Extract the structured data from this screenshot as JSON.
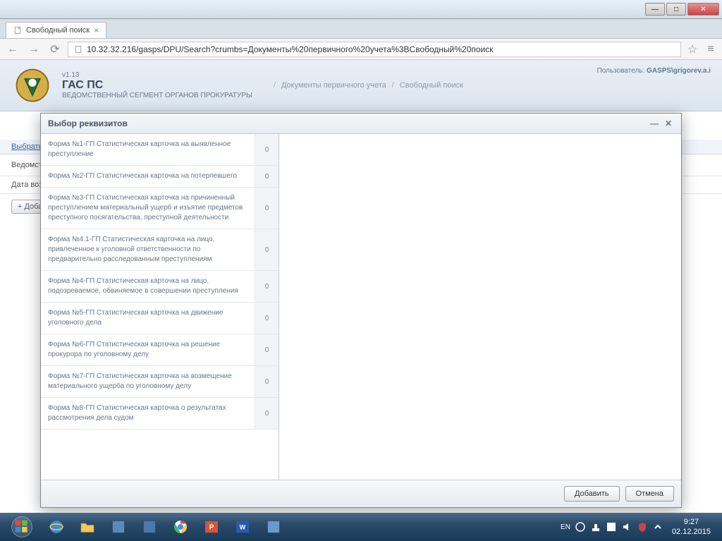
{
  "window": {
    "minimize": "—",
    "maximize": "□",
    "close": "✕"
  },
  "tab": {
    "title": "Свободный поиск",
    "close": "×"
  },
  "addr": {
    "back": "←",
    "fwd": "→",
    "reload": "⟳",
    "url": "10.32.32.216/gasps/DPU/Search?crumbs=Документы%20первичного%20учета%3BСвободный%20поиск",
    "star": "☆",
    "menu": "≡"
  },
  "header": {
    "version": "v1.13",
    "title": "ГАС ПС",
    "subtitle": "ВЕДОМСТВЕННЫЙ СЕГМЕНТ ОРГАНОВ ПРОКУРАТУРЫ",
    "bc1": "Документы первичного учета",
    "bc2": "Свободный поиск",
    "user_label": "Пользователь:",
    "user_value": "GASPS\\grigorev.a.i"
  },
  "page_title": "Свободный поиск",
  "toolbar": {
    "select_query": "Выбрать запрос..."
  },
  "form": {
    "agency_label": "Ведомство:",
    "date_label": "Дата возбуждения/отка"
  },
  "add_btn": "Добавить рекви",
  "modal": {
    "title": "Выбор реквизитов",
    "minimize": "—",
    "close": "✕",
    "add": "Добавить",
    "cancel": "Отмена",
    "items": [
      {
        "label": "Форма №1-ГП Статистическая карточка на выявленное преступление",
        "count": 0
      },
      {
        "label": "Форма №2-ГП Статистическая карточка на потерпевшего",
        "count": 0
      },
      {
        "label": "Форма №3-ГП Статистическая карточка на причиненный преступлением материальный ущерб и изъятие предметов преступного посягательства, преступной деятельности",
        "count": 0
      },
      {
        "label": "Форма №4.1-ГП Статистическая карточка на лицо, привлеченное к уголовной ответственности по предварительно расследованным преступлениям",
        "count": 0
      },
      {
        "label": "Форма №4-ГП Статистическая карточка на лицо, подозреваемое, обвиняемое в совершении преступления",
        "count": 0
      },
      {
        "label": "Форма №5-ГП Статистическая карточка на движение уголовного дела",
        "count": 0
      },
      {
        "label": "Форма №6-ГП Статистическая карточка на решение прокурора по уголовному делу",
        "count": 0
      },
      {
        "label": "Форма №7-ГП Статистическая карточка на возмещение материального ущерба по уголовному делу",
        "count": 0
      },
      {
        "label": "Форма №8-ГП Статистическая карточка о результатах рассмотрения дела судом",
        "count": 0
      }
    ]
  },
  "tray": {
    "lang": "EN",
    "time": "9:27",
    "date": "02.12.2015"
  }
}
